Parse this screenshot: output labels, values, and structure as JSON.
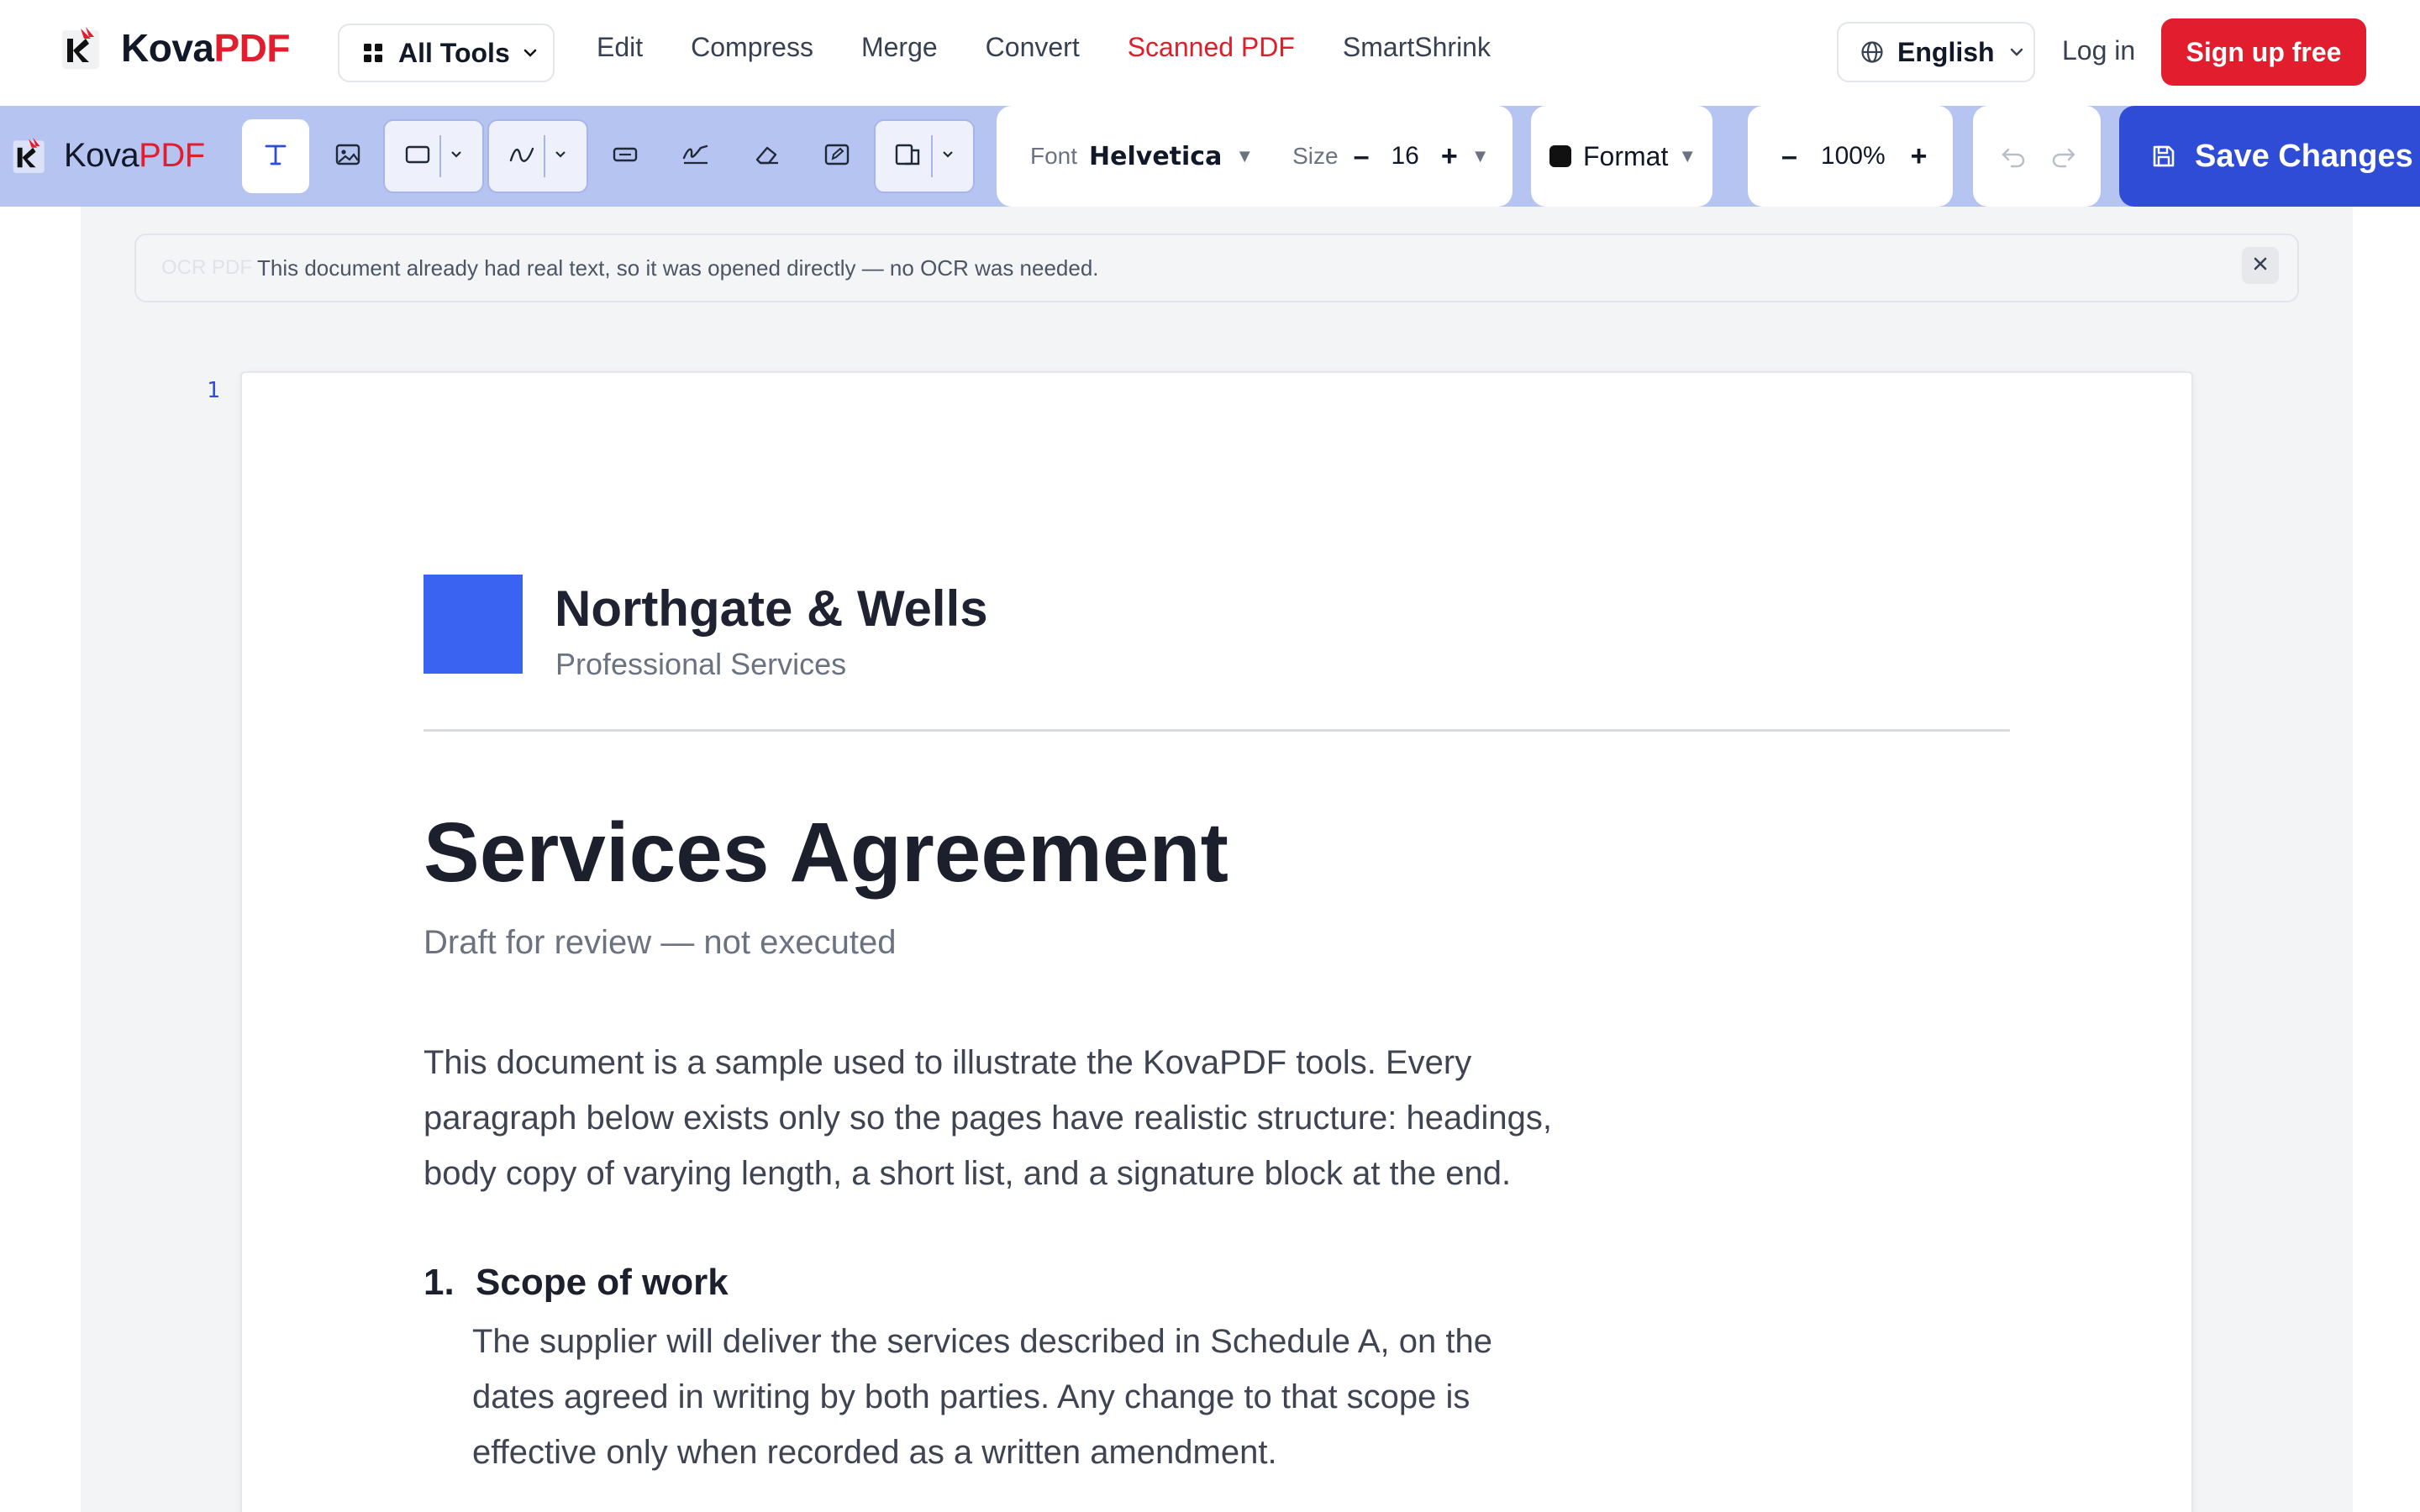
{
  "brand": {
    "name_part1": "Kova",
    "name_part2": "PDF"
  },
  "nav": {
    "all_tools": "All Tools",
    "links": [
      "Edit",
      "Compress",
      "Merge",
      "Convert",
      "Scanned PDF",
      "SmartShrink"
    ],
    "active_link": "Scanned PDF",
    "language": "English",
    "login": "Log in",
    "signup": "Sign up free"
  },
  "toolbar": {
    "tools": [
      "text-tool-icon",
      "image-icon",
      "rectangle-icon",
      "freehand-icon",
      "form-field-icon",
      "signature-icon",
      "eraser-icon",
      "edit-box-icon",
      "page-layout-icon"
    ],
    "active_tool": "text-tool-icon",
    "font_label": "Font",
    "font_value": "Helvetica",
    "size_label": "Size",
    "size_value": "16",
    "minus": "–",
    "plus": "+",
    "format_label": "Format",
    "format_color": "#111111",
    "zoom_value": "100%",
    "save_label": "Save Changes"
  },
  "banner": {
    "ghost_label": "OCR PDF",
    "message": "This document already had real text, so it was opened directly — no OCR was needed."
  },
  "document": {
    "page_number": "1",
    "company_name": "Northgate & Wells",
    "company_tagline": "Professional Services",
    "title": "Services Agreement",
    "subtitle": "Draft for review — not executed",
    "intro_lines": [
      "This document is a sample used to illustrate the KovaPDF tools. Every",
      "paragraph below exists only so the pages have realistic structure: headings,",
      "body copy of varying length, a short list, and a signature block at the end."
    ],
    "section_number": "1.",
    "section_title": "Scope of work",
    "section_lines": [
      "The supplier will deliver the services described in Schedule A, on the",
      "dates agreed in writing by both parties. Any change to that scope is",
      "effective only when recorded as a written amendment."
    ]
  },
  "colors": {
    "brand_red": "#e11d2e",
    "toolbar_bg": "#b6c4f1",
    "save_blue": "#2f4cd6",
    "doc_brand_square": "#3b63f2"
  }
}
